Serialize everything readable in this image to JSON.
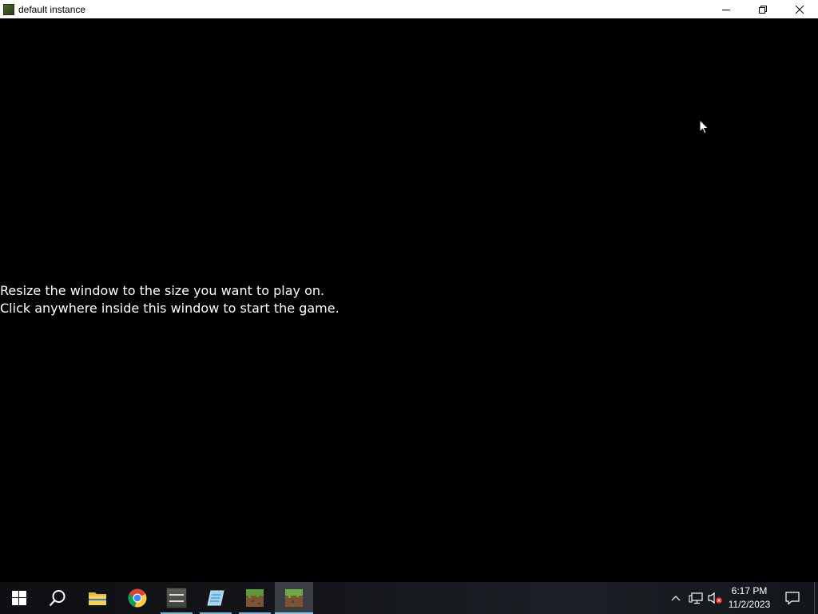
{
  "window": {
    "title": "default instance",
    "controls": [
      "minimize",
      "restore",
      "close"
    ]
  },
  "game": {
    "message_line1": "Resize the window to the size you want to play on.",
    "message_line2": "Click anywhere inside this window to start the game."
  },
  "taskbar": {
    "items": [
      {
        "name": "start-icon",
        "running": false
      },
      {
        "name": "search-icon",
        "running": false
      },
      {
        "name": "file-explorer-icon",
        "running": false
      },
      {
        "name": "chrome-icon",
        "running": false
      },
      {
        "name": "multimc-icon",
        "running": true
      },
      {
        "name": "notepad-icon",
        "running": true
      },
      {
        "name": "minecraft-launcher-icon",
        "running": true
      },
      {
        "name": "minecraft-game-icon",
        "running": true,
        "active": true
      }
    ],
    "tray": {
      "time": "6:17 PM",
      "date": "11/2/2023"
    }
  },
  "colors": {
    "titlebar": "#ffffff",
    "game_bg": "#000000",
    "message_text": "#ffffff",
    "taskbar": "#14161b"
  }
}
